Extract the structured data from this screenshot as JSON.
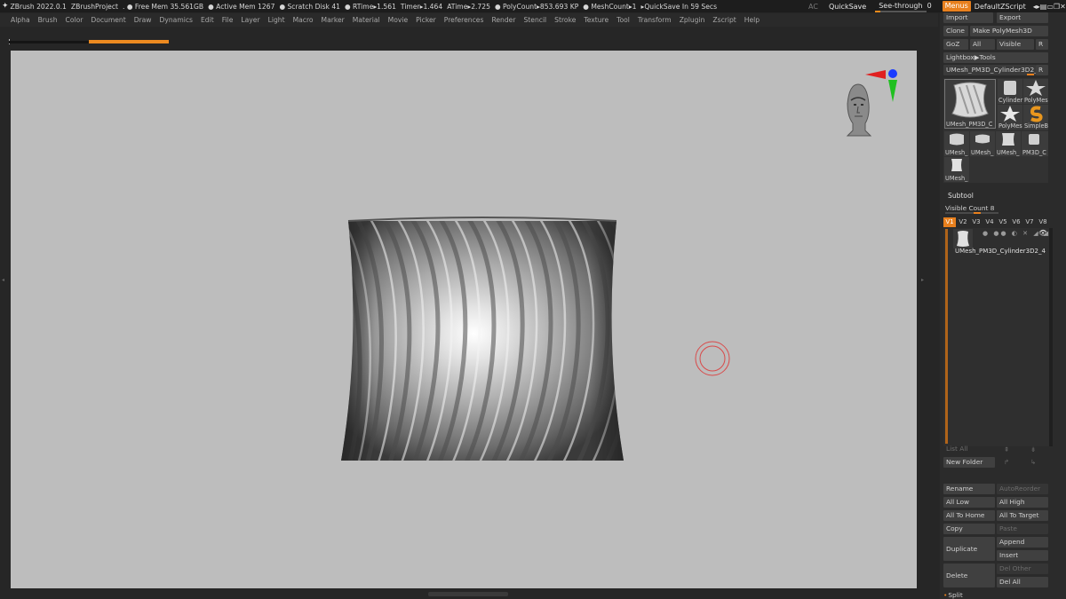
{
  "status": {
    "app": "ZBrush 2022.0.1",
    "project": "ZBrushProject",
    "free_mem": ". ● Free Mem 35.561GB",
    "active_mem": "● Active Mem 1267",
    "scratch": "● Scratch Disk 41",
    "rtime": "● RTime▸1.561",
    "timer": "Timer▸1.464",
    "atime": "ATime▸2.725",
    "polycount": "● PolyCount▸853.693 KP",
    "meshcount": "● MeshCount▸1",
    "quicksave_in": "▸QuickSave In 59 Secs",
    "ac": "AC",
    "quicksave": "QuickSave",
    "seethrough": "See-through",
    "seethrough_value": "0",
    "seethrough_level": 0,
    "menus": "Menus",
    "default_zscript": "DefaultZScript"
  },
  "menu": [
    "Alpha",
    "Brush",
    "Color",
    "Document",
    "Draw",
    "Dynamics",
    "Edit",
    "File",
    "Layer",
    "Light",
    "Macro",
    "Marker",
    "Material",
    "Movie",
    "Picker",
    "Preferences",
    "Render",
    "Stencil",
    "Stroke",
    "Texture",
    "Tool",
    "Transform",
    "Zplugin",
    "Zscript",
    "Help"
  ],
  "tool": {
    "import": "Import",
    "export": "Export",
    "clone": "Clone",
    "make_polymesh": "Make PolyMesh3D",
    "goz": "GoZ",
    "all": "All",
    "visible": "Visible",
    "r": "R",
    "lightbox": "Lightbox▶Tools",
    "current": "UMesh_PM3D_Cylinder3D2_4",
    "current_r": "R",
    "thumbs": [
      {
        "cap": "UMesh_PM3D_C"
      },
      {
        "cap": "Cylinder"
      },
      {
        "cap": "PolyMes"
      },
      {
        "cap": "PolyMes"
      },
      {
        "cap": "SimpleB"
      },
      {
        "cap": "UMesh_"
      },
      {
        "cap": "UMesh_"
      },
      {
        "cap": "UMesh_"
      },
      {
        "cap": "PM3D_C"
      },
      {
        "cap": "UMesh_"
      }
    ]
  },
  "subtool": {
    "title": "Subtool",
    "visible_count": "Visible Count 8",
    "tabs": [
      "V1",
      "V2",
      "V3",
      "V4",
      "V5",
      "V6",
      "V7",
      "V8"
    ],
    "item": "UMesh_PM3D_Cylinder3D2_4",
    "list_all": "List All",
    "new_folder": "New Folder",
    "rename": "Rename",
    "auto_reorder": "AutoReorder",
    "all_low": "All Low",
    "all_high": "All High",
    "all_to_home": "All To Home",
    "all_to_target": "All To Target",
    "copy": "Copy",
    "paste": "Paste",
    "duplicate": "Duplicate",
    "append": "Append",
    "insert": "Insert",
    "delete": "Delete",
    "del_other": "Del Other",
    "del_all": "Del All",
    "split": "Split"
  },
  "colors": {
    "accent": "#e8801e",
    "canvas": "#bdbdbd",
    "panel": "#2b2b2b"
  }
}
